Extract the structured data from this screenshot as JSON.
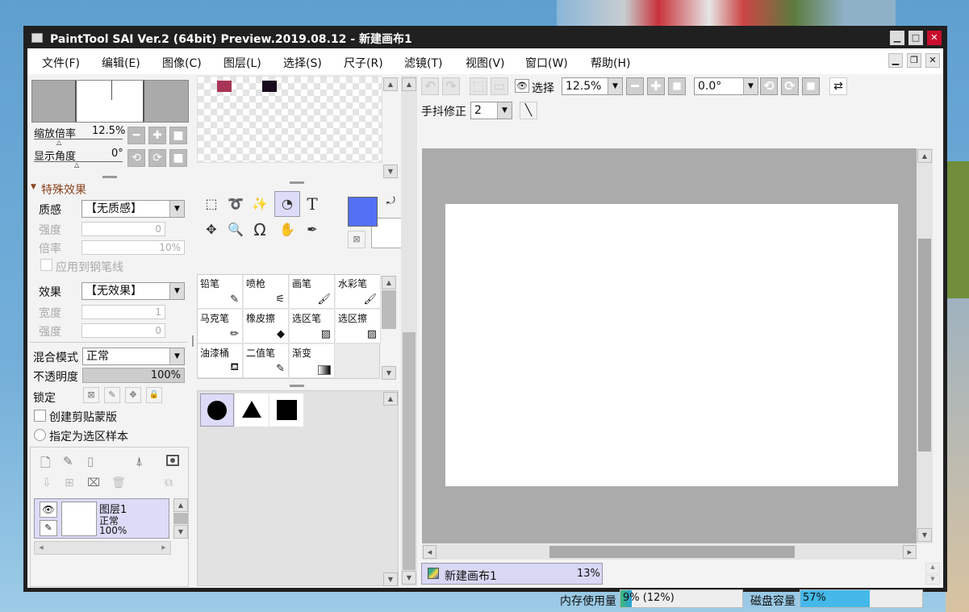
{
  "window": {
    "title": "PaintTool SAI Ver.2 (64bit) Preview.2019.08.12 - 新建画布1"
  },
  "menu": [
    "文件(F)",
    "编辑(E)",
    "图像(C)",
    "图层(L)",
    "选择(S)",
    "尺子(R)",
    "滤镜(T)",
    "视图(V)",
    "窗口(W)",
    "帮助(H)"
  ],
  "navigator": {
    "zoom_label": "缩放倍率",
    "zoom_value": "12.5%",
    "angle_label": "显示角度",
    "angle_value": "0°"
  },
  "effects": {
    "header": "特殊效果",
    "texture_label": "质感",
    "texture_value": "【无质感】",
    "strength_label": "强度",
    "strength_value": "0",
    "scale_label": "倍率",
    "scale_value": "10%",
    "apply_pen_label": "应用到钢笔线",
    "effect_label": "效果",
    "effect_value": "【无效果】",
    "width_label": "宽度",
    "width_value": "1",
    "strength2_label": "强度",
    "strength2_value": "0"
  },
  "layer_props": {
    "blend_label": "混合模式",
    "blend_value": "正常",
    "opacity_label": "不透明度",
    "opacity_value": "100%",
    "lock_label": "锁定",
    "clip_label": "创建剪贴蒙版",
    "selsrc_label": "指定为选区样本"
  },
  "layer": {
    "name": "图层1",
    "mode": "正常",
    "opacity": "100%"
  },
  "swatches": [
    "#a83456",
    "#1a0a1e"
  ],
  "colors": {
    "primary": "#5470f5",
    "secondary": "#ffffff"
  },
  "brushes": [
    {
      "name": "铅笔",
      "icon": "pencil-icon"
    },
    {
      "name": "喷枪",
      "icon": "airbrush-icon"
    },
    {
      "name": "画笔",
      "icon": "brush-icon"
    },
    {
      "name": "水彩笔",
      "icon": "watercolor-icon"
    },
    {
      "name": "马克笔",
      "icon": "marker-icon"
    },
    {
      "name": "橡皮擦",
      "icon": "eraser-icon"
    },
    {
      "name": "选区笔",
      "icon": "selection-pen-icon"
    },
    {
      "name": "选区擦",
      "icon": "selection-eraser-icon"
    },
    {
      "name": "油漆桶",
      "icon": "bucket-icon"
    },
    {
      "name": "二值笔",
      "icon": "binary-pen-icon"
    },
    {
      "name": "渐变",
      "icon": "gradient-icon"
    }
  ],
  "toolbar": {
    "view_label": "选择",
    "zoom": "12.5%",
    "angle": "0.0°",
    "stabilizer_label": "手抖修正",
    "stabilizer_value": "2"
  },
  "canvas_tab": {
    "name": "新建画布1",
    "zoom": "13%"
  },
  "status": {
    "mem_label": "内存使用量",
    "mem_value": "9% (12%)",
    "mem_fraction": 0.09,
    "disk_label": "磁盘容量",
    "disk_value": "57%",
    "disk_fraction": 0.57
  }
}
